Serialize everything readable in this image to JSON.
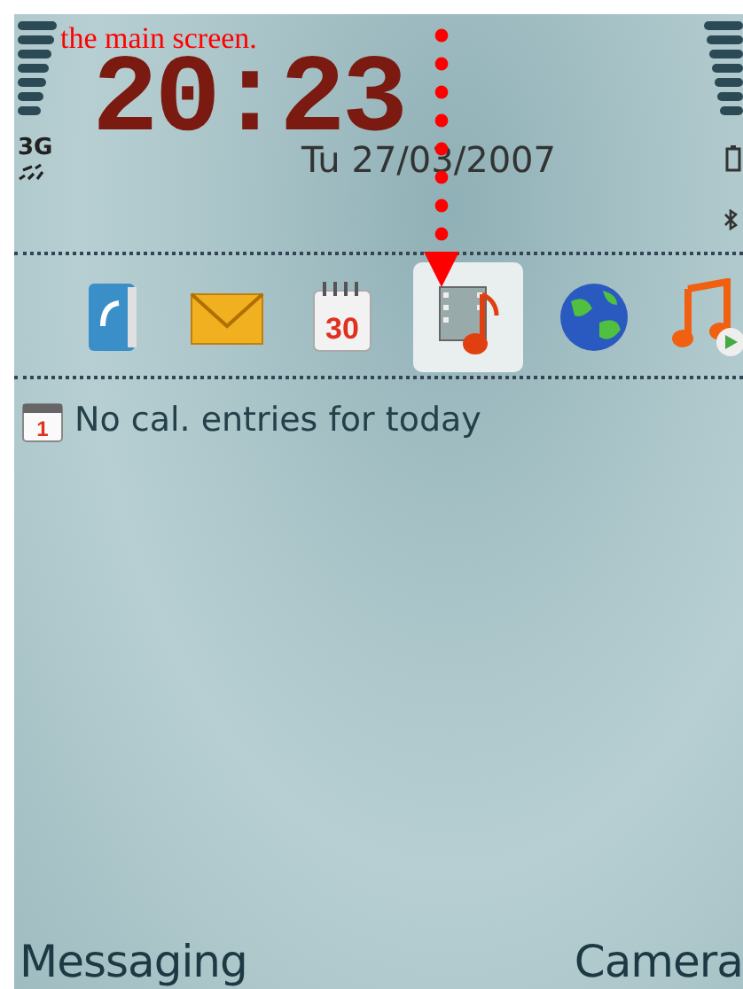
{
  "annotation": {
    "text": "the main screen."
  },
  "status": {
    "network": "3G",
    "clock": "20:23",
    "date": "Tu 27/03/2007"
  },
  "shortcuts": [
    {
      "kind": "contacts",
      "selected": false
    },
    {
      "kind": "mail",
      "selected": false
    },
    {
      "kind": "calendar",
      "icon_text": "30",
      "selected": false
    },
    {
      "kind": "media",
      "selected": true
    },
    {
      "kind": "web",
      "selected": false
    },
    {
      "kind": "music",
      "selected": false
    }
  ],
  "calendar_row": {
    "icon_text": "1",
    "text": "No cal. entries for today"
  },
  "softkeys": {
    "left": "Messaging",
    "right": "Camera"
  }
}
